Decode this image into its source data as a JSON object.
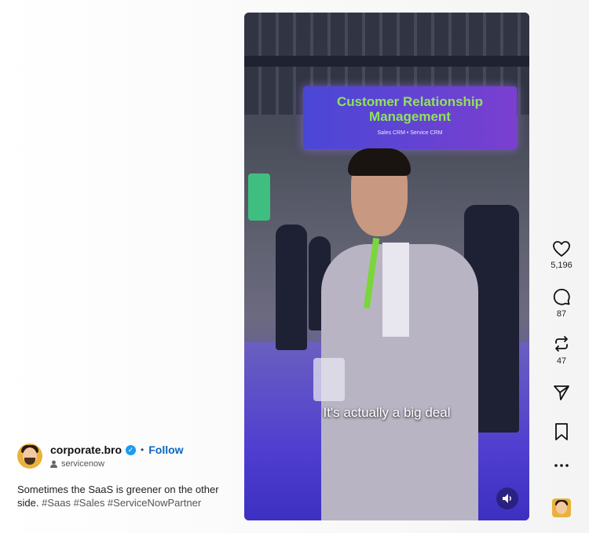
{
  "post": {
    "username": "corporate.bro",
    "separator": "•",
    "follow_label": "Follow",
    "audio_label": "servicenow",
    "caption": "Sometimes the SaaS is greener on the other side.",
    "hashtags": "#Saas #Sales #ServiceNowPartner"
  },
  "video": {
    "banner_title": "Customer Relationship Management",
    "banner_sub": "Sales CRM • Service CRM",
    "subtitle": "It's actually a big deal"
  },
  "actions": {
    "likes": "5,196",
    "comments": "87",
    "reposts": "47"
  },
  "icons": {
    "verified": "verified-badge-icon",
    "audio": "person-icon",
    "like": "heart-icon",
    "comment": "comment-icon",
    "repost": "repost-icon",
    "share": "send-icon",
    "save": "bookmark-icon",
    "more": "more-icon",
    "mute": "speaker-icon"
  },
  "colors": {
    "follow": "#0a66c2",
    "verified": "#1d9bf0",
    "banner_text": "#8fe35a"
  }
}
